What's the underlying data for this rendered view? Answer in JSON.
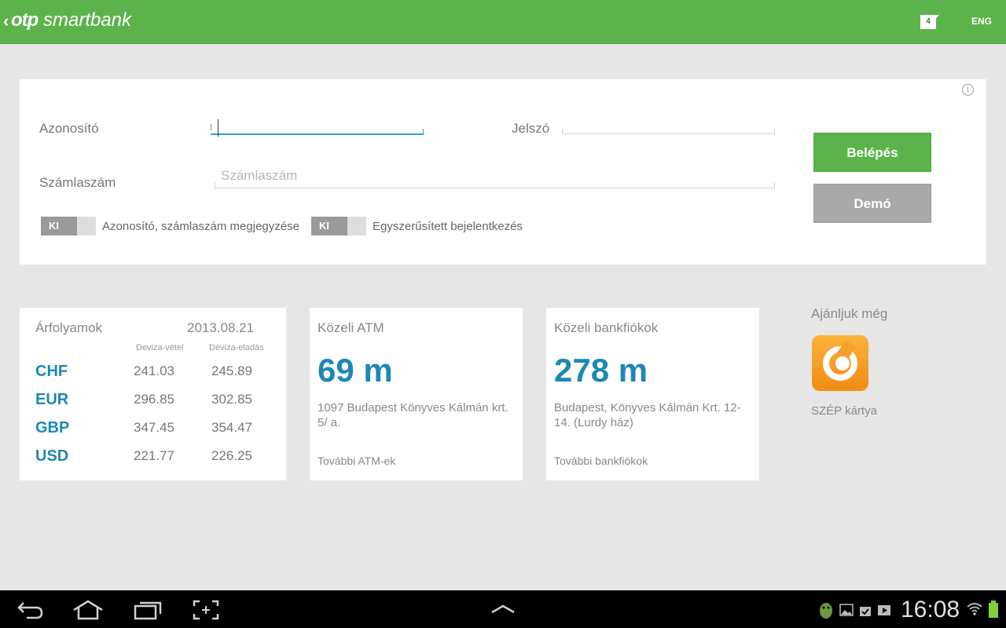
{
  "header": {
    "back_glyph": "‹",
    "logo_otp": "otp",
    "logo_rest": " smartbank",
    "notification_count": "4",
    "language": "ENG",
    "bar_color": "#5cb34a"
  },
  "login": {
    "id_label": "Azonosító",
    "id_value": "",
    "password_label": "Jelszó",
    "password_value": "",
    "account_label": "Számlaszám",
    "account_placeholder": "Számlaszám",
    "remember_toggle": {
      "state": "KI",
      "label": "Azonosító, számlaszám megjegyzése"
    },
    "simple_login_toggle": {
      "state": "KI",
      "label": "Egyszerűsített bejelentkezés"
    },
    "login_button": "Belépés",
    "demo_button": "Demó",
    "info_glyph": "i"
  },
  "rates": {
    "title": "Árfolyamok",
    "date": "2013.08.21",
    "buy_header": "Deviza-vétel",
    "sell_header": "Deviza-eladás",
    "rows": [
      {
        "currency": "CHF",
        "buy": "241.03",
        "sell": "245.89"
      },
      {
        "currency": "EUR",
        "buy": "296.85",
        "sell": "302.85"
      },
      {
        "currency": "GBP",
        "buy": "347.45",
        "sell": "354.47"
      },
      {
        "currency": "USD",
        "buy": "221.77",
        "sell": "226.25"
      }
    ]
  },
  "atm": {
    "title": "Közeli ATM",
    "distance": "69 m",
    "address": "1097 Budapest Könyves Kálmán krt. 5/ a.",
    "more_link": "További ATM-ek"
  },
  "branch": {
    "title": "Közeli bankfiókok",
    "distance": "278 m",
    "address": "Budapest, Könyves Kálmán Krt. 12-14. (Lurdy ház)",
    "more_link": "További bankfiókok"
  },
  "recommend": {
    "title": "Ajánljuk még",
    "app_label": "SZÉP kártya"
  },
  "system": {
    "time": "16:08"
  }
}
